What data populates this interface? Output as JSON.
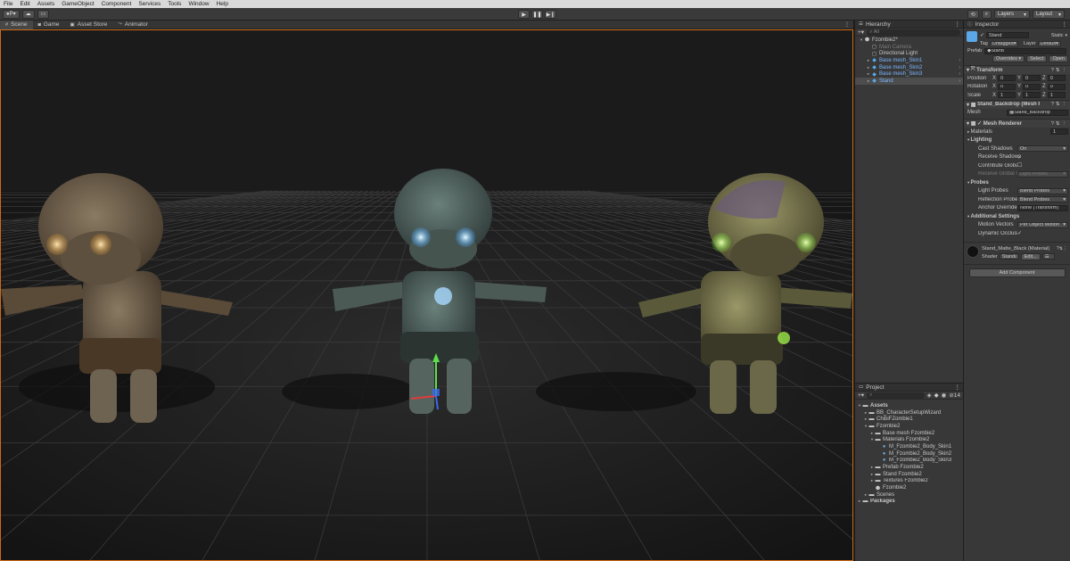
{
  "menu": [
    "File",
    "Edit",
    "Assets",
    "GameObject",
    "Component",
    "Services",
    "Tools",
    "Window",
    "Help"
  ],
  "toolbar": {
    "account_label": "P",
    "layers_label": "Layers",
    "layout_label": "Layout"
  },
  "scene_tabs": [
    {
      "label": "Scene",
      "icon": "hash-icon"
    },
    {
      "label": "Game",
      "icon": "gamepad-icon"
    },
    {
      "label": "Asset Store",
      "icon": "store-icon"
    },
    {
      "label": "Animator",
      "icon": "animator-icon"
    }
  ],
  "hierarchy": {
    "title": "Hierarchy",
    "search": "All",
    "items": [
      {
        "label": "Fzombie2*",
        "depth": 0,
        "expanded": true,
        "type": "scene",
        "color": "white"
      },
      {
        "label": "Main Camera",
        "depth": 1,
        "type": "object",
        "color": "dim"
      },
      {
        "label": "Directional Light",
        "depth": 1,
        "type": "object",
        "color": "white"
      },
      {
        "label": "Base mesh_Skin1",
        "depth": 1,
        "type": "prefab",
        "color": "blue",
        "arrow": true
      },
      {
        "label": "Base mesh_Skin2",
        "depth": 1,
        "type": "prefab",
        "color": "blue",
        "arrow": true
      },
      {
        "label": "Base mesh_Skin3",
        "depth": 1,
        "type": "prefab",
        "color": "blue",
        "arrow": true
      },
      {
        "label": "Stand",
        "depth": 1,
        "type": "prefab",
        "color": "blue",
        "arrow": true,
        "selected": true
      }
    ]
  },
  "project": {
    "title": "Project",
    "count": "14",
    "items": [
      {
        "label": "Assets",
        "depth": 0,
        "type": "folder",
        "bold": true,
        "expanded": true
      },
      {
        "label": "BB_CharacterSetupWizard",
        "depth": 1,
        "type": "folder"
      },
      {
        "label": "ChibiFZombie1",
        "depth": 1,
        "type": "folder"
      },
      {
        "label": "Fzombie2",
        "depth": 1,
        "type": "folder",
        "expanded": true
      },
      {
        "label": "Base mesh Fzombie2",
        "depth": 2,
        "type": "folder"
      },
      {
        "label": "Materials Fzombie2",
        "depth": 2,
        "type": "folder",
        "expanded": true
      },
      {
        "label": "M_Fzombie2_Body_Skin1",
        "depth": 3,
        "type": "material"
      },
      {
        "label": "M_Fzombie2_Body_Skin2",
        "depth": 3,
        "type": "material"
      },
      {
        "label": "M_Fzombie2_Body_Skin3",
        "depth": 3,
        "type": "material"
      },
      {
        "label": "Prefab Fzombie2",
        "depth": 2,
        "type": "folder"
      },
      {
        "label": "Stand Fzombie2",
        "depth": 2,
        "type": "folder"
      },
      {
        "label": "Textures Fzombie2",
        "depth": 2,
        "type": "folder"
      },
      {
        "label": "Fzombie2",
        "depth": 2,
        "type": "scene"
      },
      {
        "label": "Scenes",
        "depth": 1,
        "type": "folder"
      },
      {
        "label": "Packages",
        "depth": 0,
        "type": "folder",
        "bold": true
      }
    ]
  },
  "inspector": {
    "title": "Inspector",
    "object_name": "Stand",
    "static_label": "Static",
    "tag_label": "Tag",
    "tag_value": "Untagged",
    "layer_label": "Layer",
    "layer_value": "Default",
    "prefab_label": "Prefab",
    "prefab_value": "Stand",
    "overrides": "Overrides",
    "select": "Select",
    "open": "Open",
    "transform": {
      "title": "Transform",
      "rows": [
        {
          "label": "Position",
          "x": "0",
          "y": "0",
          "z": "0"
        },
        {
          "label": "Rotation",
          "x": "0",
          "y": "0",
          "z": "0"
        },
        {
          "label": "Scale",
          "x": "1",
          "y": "1",
          "z": "1"
        }
      ]
    },
    "mesh_filter": {
      "title": "Stand_Backdrop (Mesh Filter)",
      "mesh_label": "Mesh",
      "mesh_value": "Stand_Backdrop"
    },
    "mesh_renderer": {
      "title": "Mesh Renderer",
      "materials_label": "Materials",
      "materials_count": "1",
      "lighting_label": "Lighting",
      "cast_shadows_label": "Cast Shadows",
      "cast_shadows_value": "On",
      "receive_shadows_label": "Receive Shadows",
      "contribute_gi_label": "Contribute Global Illumination",
      "receive_gi_label": "Receive Global Illumination",
      "receive_gi_value": "Light Probes",
      "probes_label": "Probes",
      "light_probes_label": "Light Probes",
      "light_probes_value": "Blend Probes",
      "reflection_probes_label": "Reflection Probes",
      "reflection_probes_value": "Blend Probes",
      "anchor_override_label": "Anchor Override",
      "anchor_override_value": "None (Transform)",
      "additional_label": "Additional Settings",
      "motion_vectors_label": "Motion Vectors",
      "motion_vectors_value": "Per Object Motion",
      "dynamic_occlusion_label": "Dynamic Occlusion"
    },
    "material": {
      "name": "Stand_Matte_Black (Material)",
      "shader_label": "Shader",
      "shader_value": "Standard",
      "edit_label": "Edit..."
    },
    "add_component": "Add Component"
  },
  "colors": {
    "accent": "#d06a18",
    "selection": "#4d4d4d",
    "prefab_blue": "#7ab6ff",
    "panel": "#383838"
  }
}
